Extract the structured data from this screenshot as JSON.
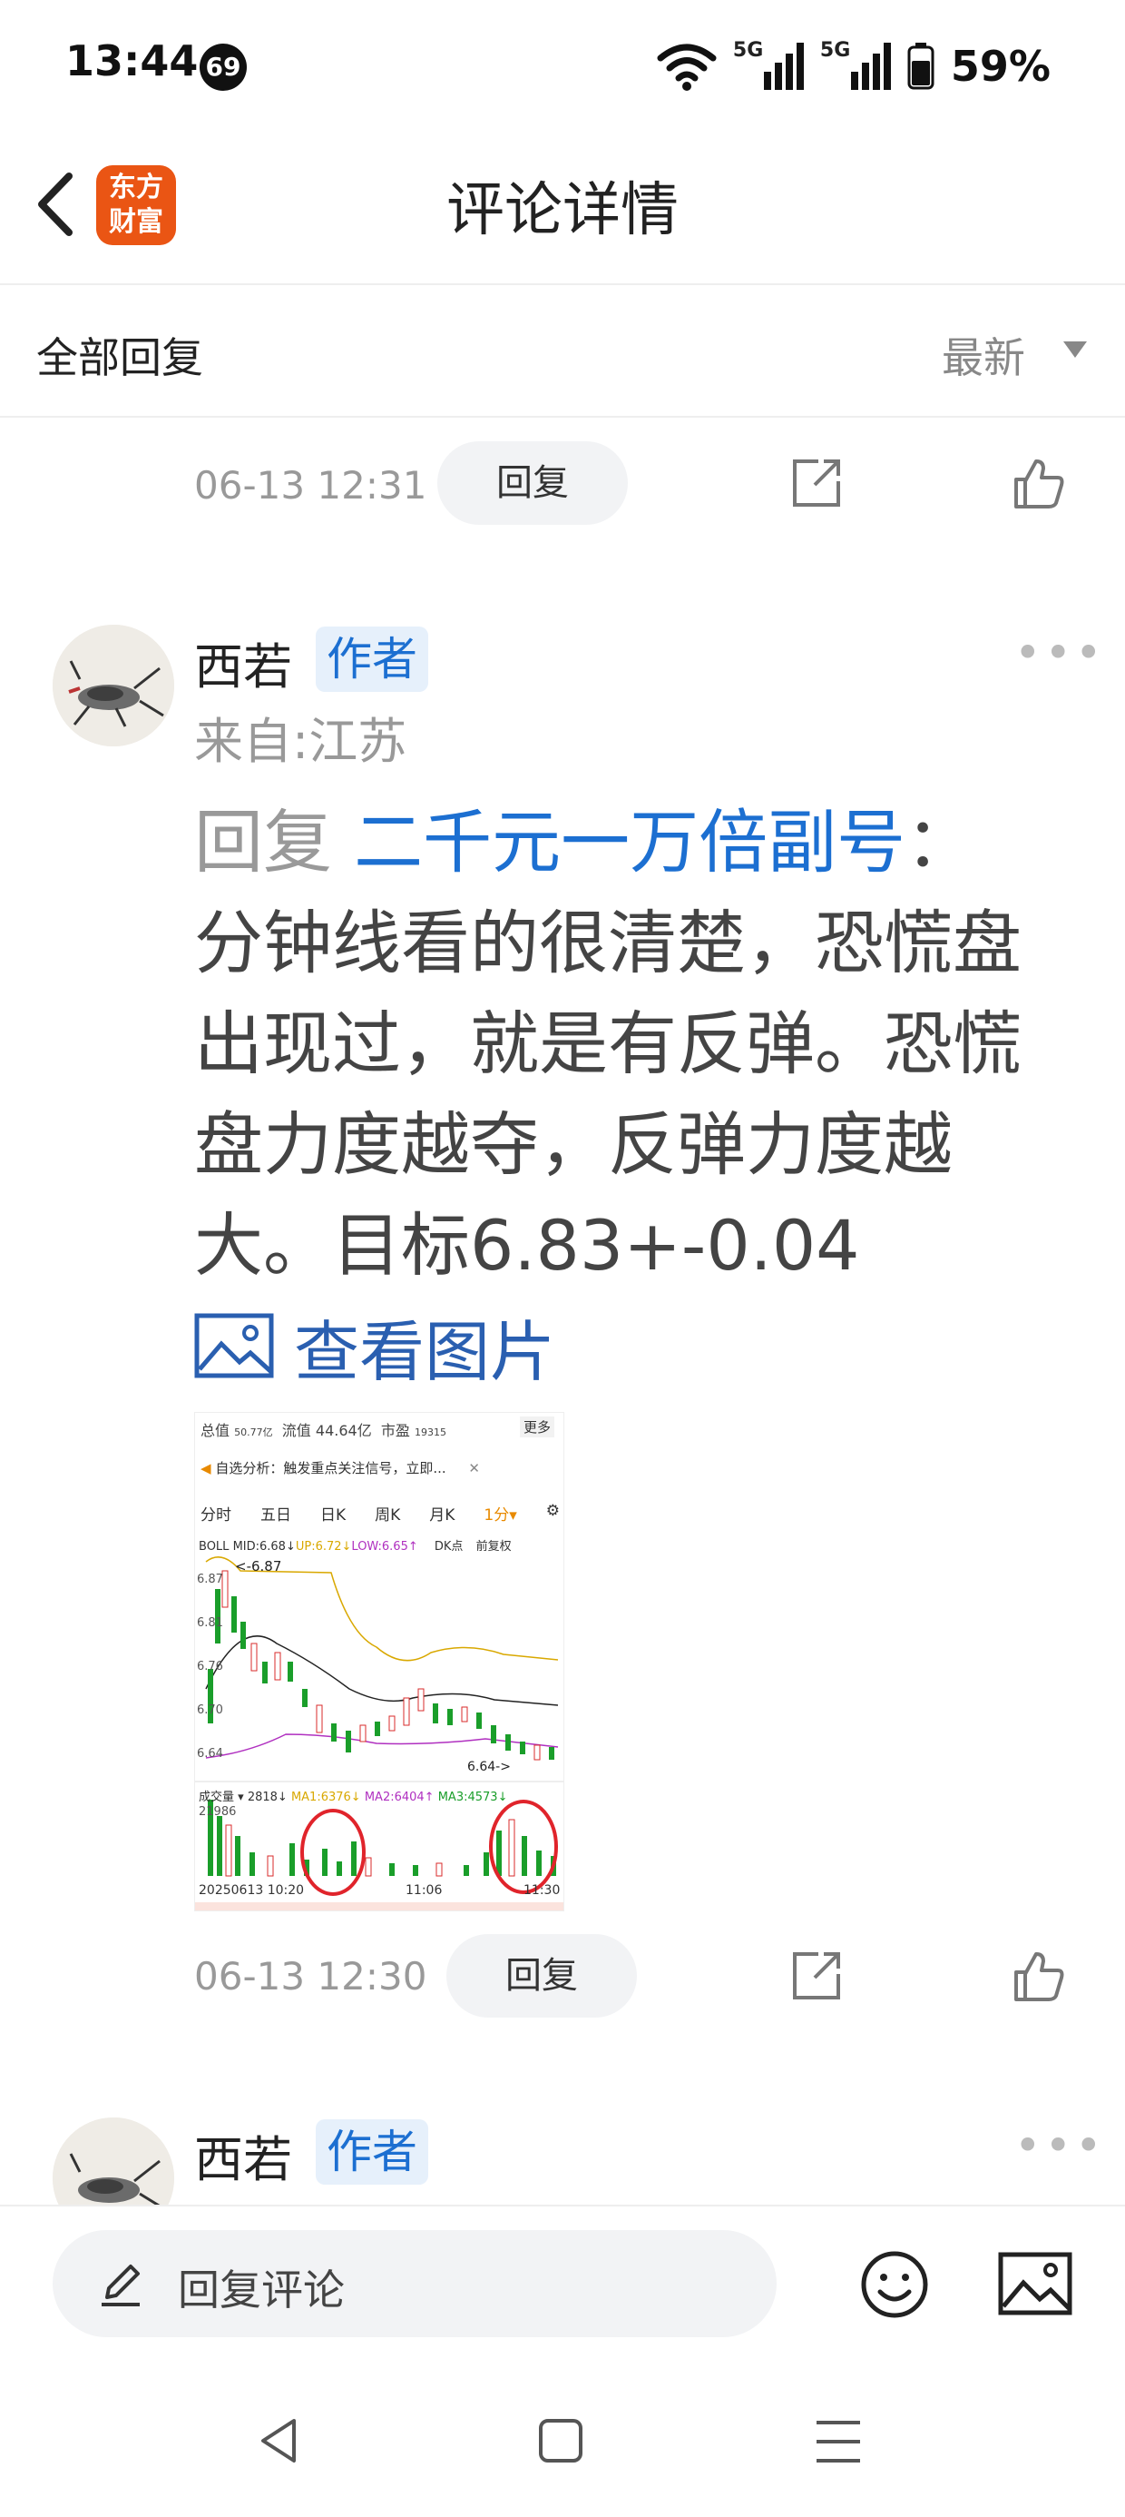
{
  "status": {
    "time": "13:44",
    "badge": "69",
    "net1": "5G",
    "net2": "5G",
    "battery": "59%"
  },
  "header": {
    "title": "评论详情",
    "logo_line1": "东方",
    "logo_line2": "财富"
  },
  "filter": {
    "label": "全部回复",
    "sort": "最新"
  },
  "previous_item": {
    "time": "06-13 12:31",
    "reply_label": "回复"
  },
  "comment": {
    "username": "西若",
    "badge": "作者",
    "location": "来自:江苏",
    "reply_prefix": "回复 ",
    "mention": "二千元一万倍副号",
    "colon": "：",
    "text": "分钟线看的很清楚，恐慌盘出现过，就是有反弹。恐慌盘力度越夺，反弹力度越大。目标6.83+-0.04",
    "view_image": "查看图片",
    "time": "06-13 12:30",
    "reply_label": "回复"
  },
  "next_comment": {
    "username": "西若",
    "badge": "作者"
  },
  "bottom": {
    "reply_placeholder": "回复评论"
  },
  "thumbnail": {
    "row1_a": "总值",
    "row1_a_val": "50.77亿",
    "row1_b": "流值",
    "row1_b_val": "44.64亿",
    "row1_c": "市盈",
    "row1_c_val": "19315",
    "more": "更多",
    "alert": "自选分析：触发重点关注信号，立即...",
    "tabs": [
      "分时",
      "五日",
      "日K",
      "周K",
      "月K",
      "1分▾"
    ],
    "boll_label": "BOLL",
    "boll_mid": "MID:6.68↓",
    "boll_up": "UP:6.72↓",
    "boll_low": "LOW:6.65↑",
    "dk": "DK点",
    "fq": "前复权",
    "price_high": "6.87",
    "price_high_mark": "<-6.87",
    "y_labels": [
      "6.87",
      "6.81",
      "6.76",
      "6.70",
      "6.64"
    ],
    "price_low_mark": "6.64->",
    "vol_label": "成交量",
    "vol_val": "2818↓",
    "ma1": "MA1:6376↓",
    "ma2": "MA2:6404↑",
    "ma3": "MA3:4573↓",
    "vol_top": "21986",
    "x_labels": [
      "20250613 10:20",
      "11:06",
      "11:30"
    ]
  },
  "colors": {
    "accent_blue": "#1c6fd1",
    "logo_orange": "#ea5514",
    "candle_green": "#1a9e2a",
    "candle_red": "#d92b2b",
    "circle_red": "#e0242b"
  }
}
